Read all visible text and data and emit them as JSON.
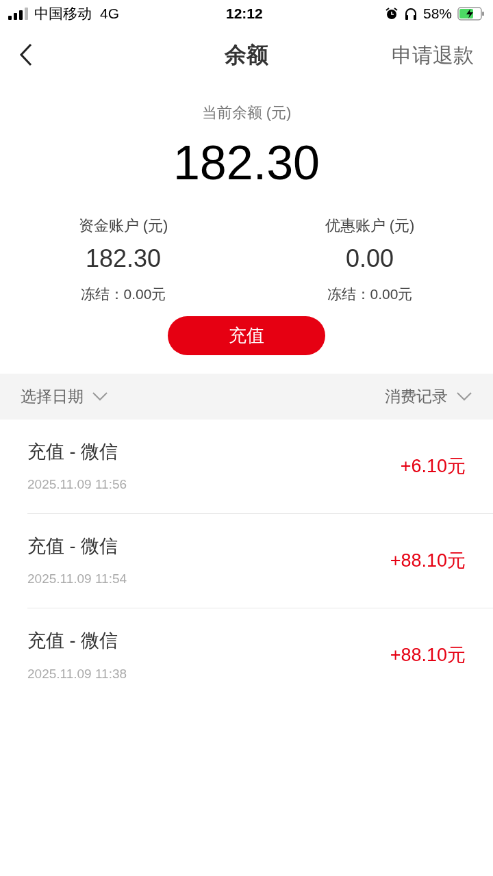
{
  "status_bar": {
    "carrier": "中国移动",
    "network": "4G",
    "time": "12:12",
    "battery": "58%"
  },
  "nav": {
    "title": "余额",
    "action": "申请退款"
  },
  "balance": {
    "label": "当前余额 (元)",
    "amount": "182.30"
  },
  "accounts": [
    {
      "label": "资金账户 (元)",
      "amount": "182.30",
      "frozen": "冻结：0.00元"
    },
    {
      "label": "优惠账户 (元)",
      "amount": "0.00",
      "frozen": "冻结：0.00元"
    }
  ],
  "recharge_button": "充值",
  "filters": [
    "选择日期",
    "消费记录"
  ],
  "records": [
    {
      "title": "充值 - 微信",
      "time": "2025.11.09 11:56",
      "amount": "+6.10元"
    },
    {
      "title": "充值 - 微信",
      "time": "2025.11.09 11:54",
      "amount": "+88.10元"
    },
    {
      "title": "充值 - 微信",
      "time": "2025.11.09 11:38",
      "amount": "+88.10元"
    }
  ]
}
